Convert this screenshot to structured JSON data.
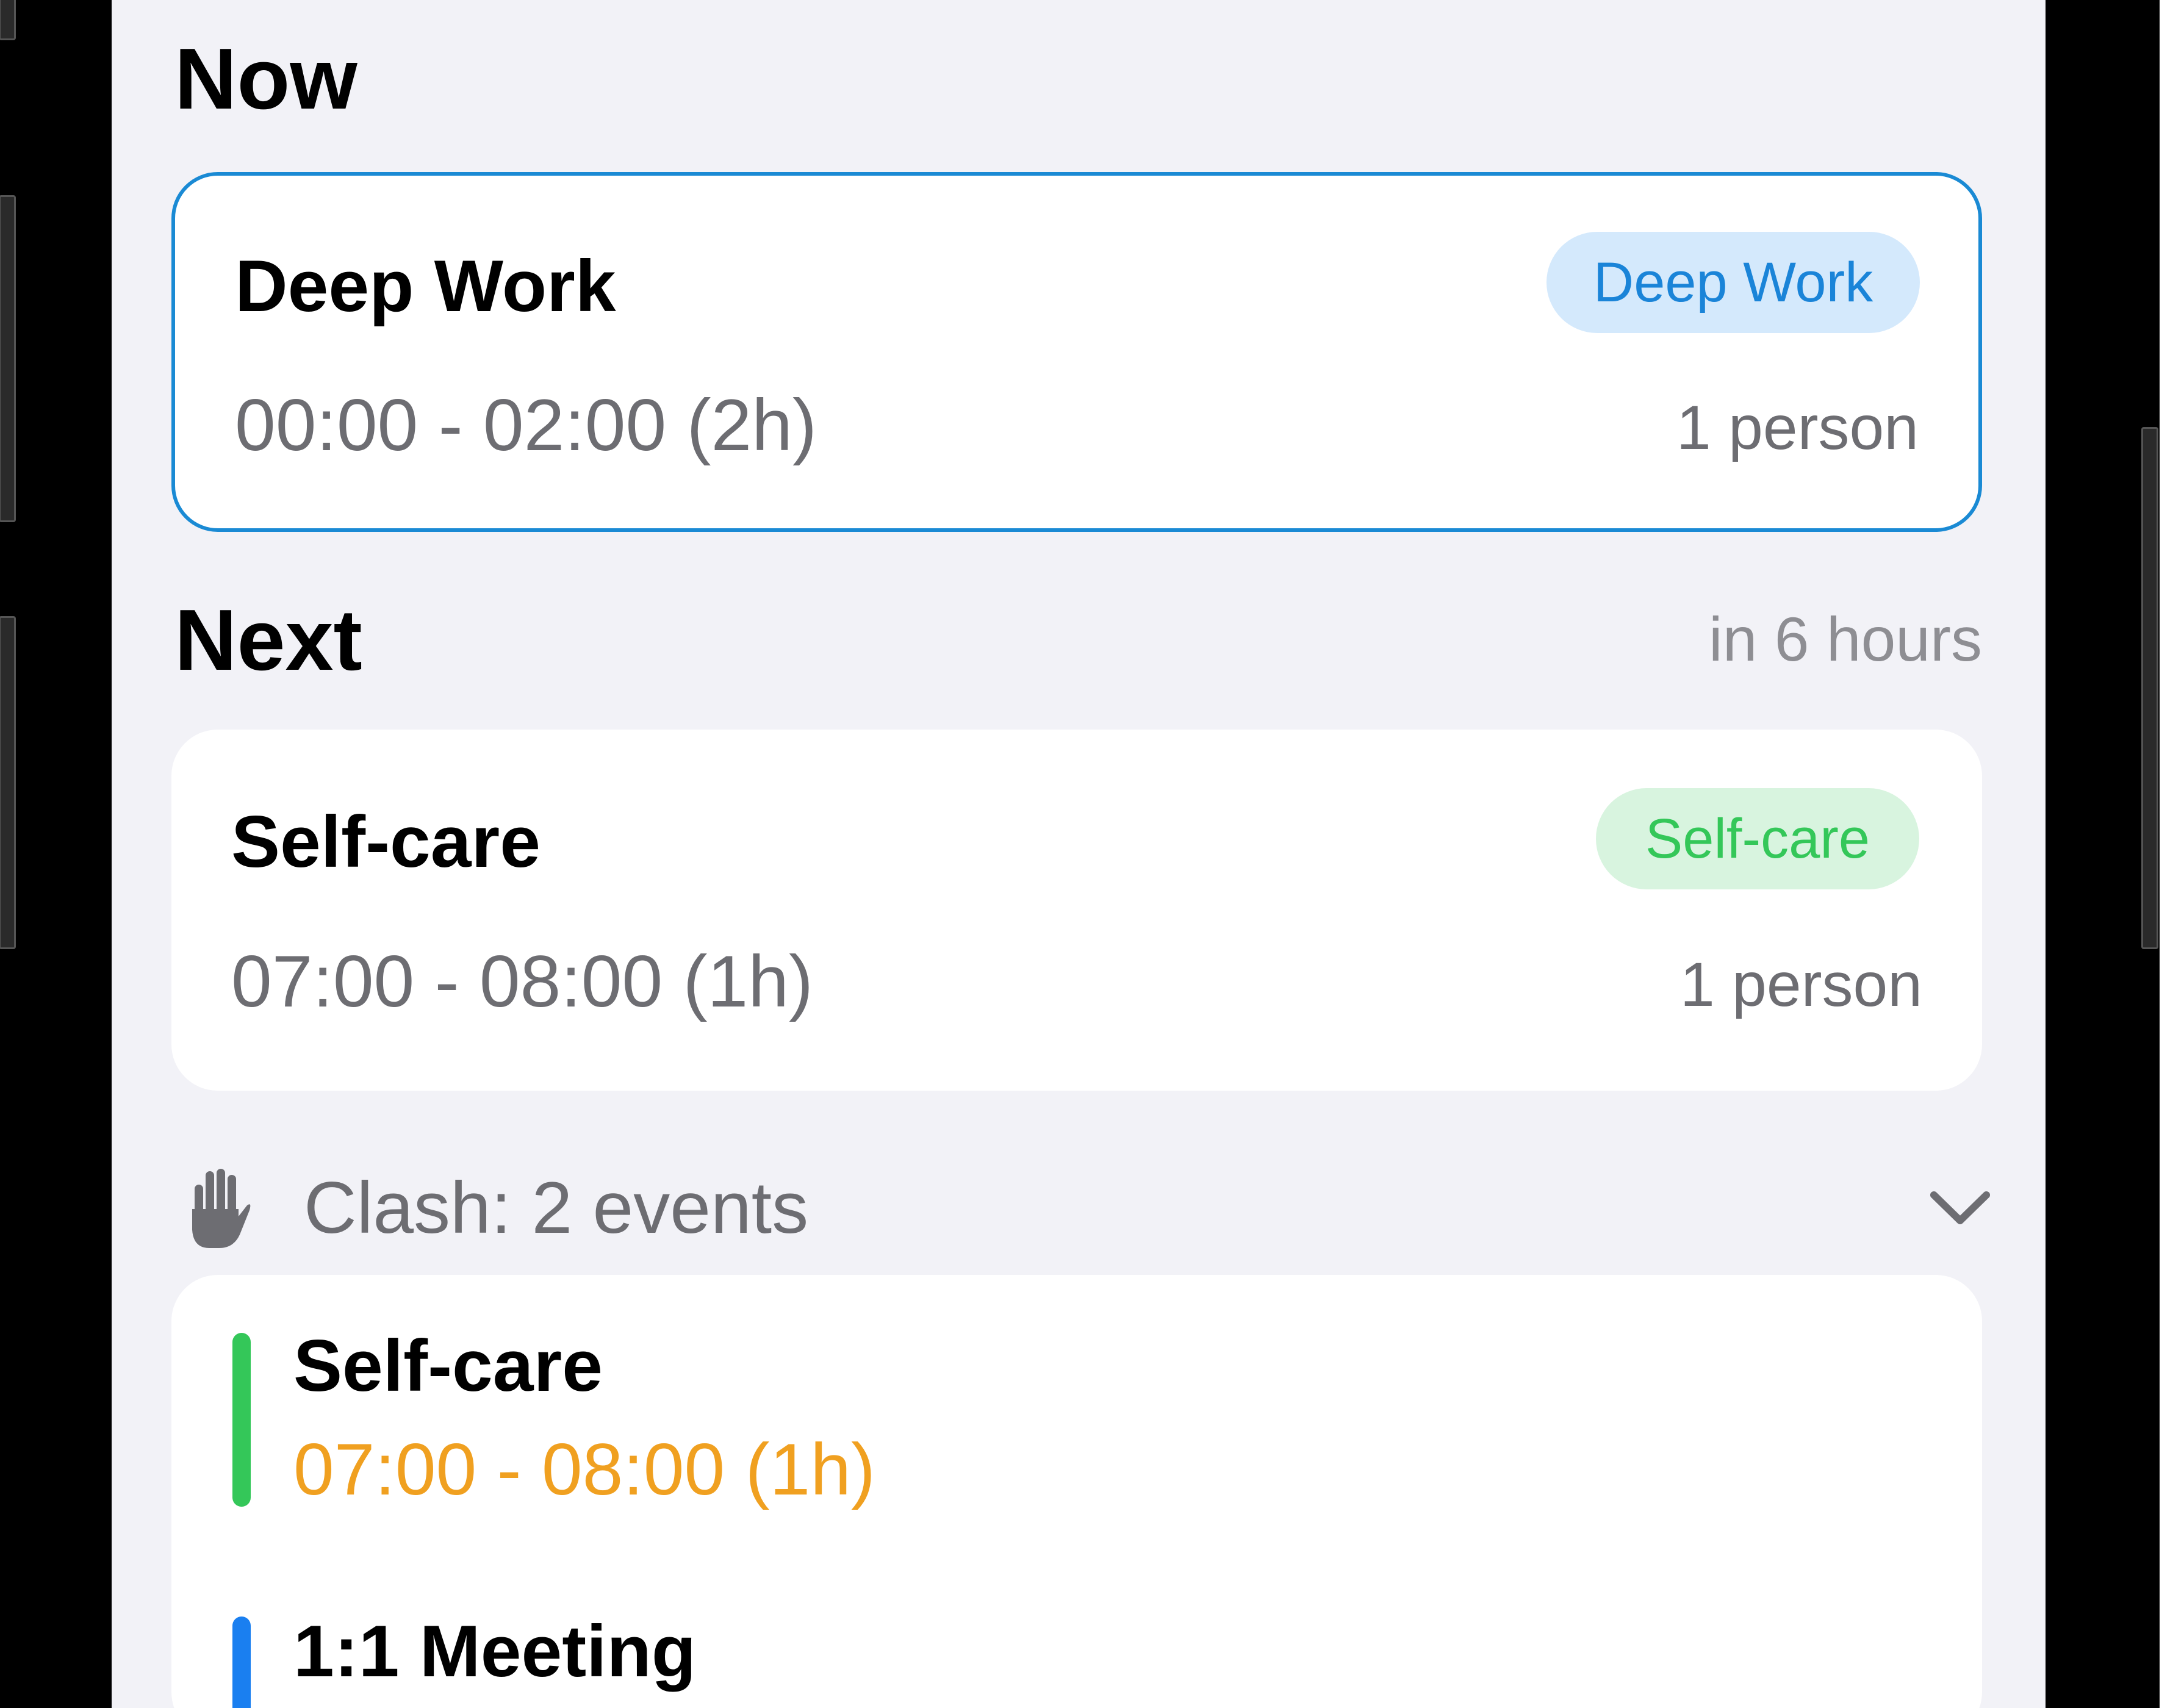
{
  "now": {
    "title": "Now",
    "event": {
      "title": "Deep Work",
      "tag": "Deep Work",
      "time": "00:00 - 02:00 (2h)",
      "people": "1 person"
    }
  },
  "next": {
    "title": "Next",
    "relative": "in 6 hours",
    "event": {
      "title": "Self-care",
      "tag": "Self-care",
      "time": "07:00 - 08:00 (1h)",
      "people": "1 person"
    }
  },
  "clash": {
    "label": "Clash: 2 events",
    "icon": "hand-raised-icon",
    "expand_icon": "chevron-down-icon",
    "events": [
      {
        "title": "Self-care",
        "time": "07:00 - 08:00 (1h)",
        "color": "#34c759"
      },
      {
        "title": "1:1 Meeting",
        "time": "",
        "color": "#1a7ff0"
      }
    ]
  },
  "colors": {
    "accent_blue": "#1a8ad4",
    "self_care_green": "#34c759",
    "clash_orange": "#f0a020",
    "meeting_blue": "#1a7ff0"
  }
}
